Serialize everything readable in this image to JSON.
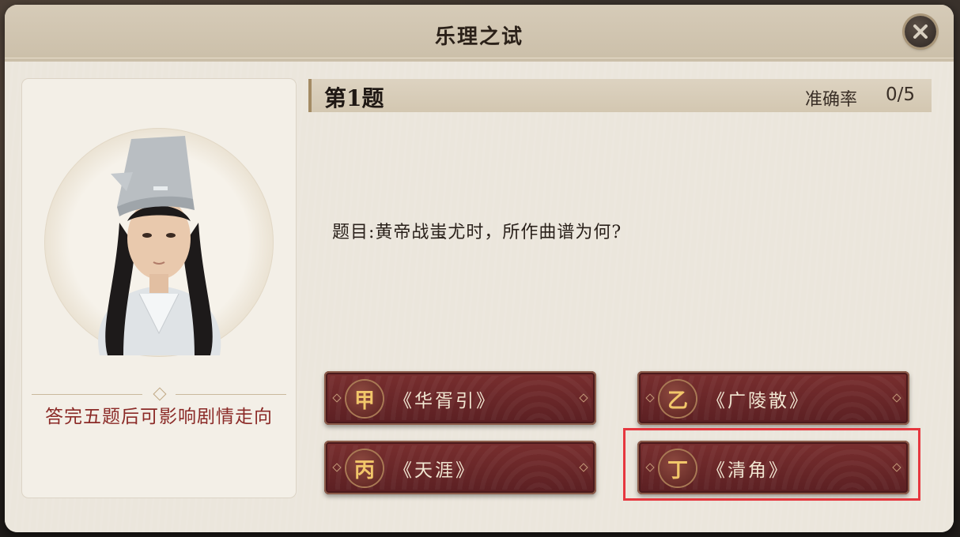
{
  "dialog": {
    "title": "乐理之试",
    "close_icon": "close-x-icon"
  },
  "left_panel": {
    "portrait": "npc-scholar-portrait",
    "hint": "答完五题后可影响剧情走向"
  },
  "question": {
    "number_label": "第1题",
    "accuracy_label": "准确率",
    "accuracy_value": "0/5",
    "text": "题目:黄帝战蚩尤时，所作曲谱为何?"
  },
  "options": [
    {
      "marker": "甲",
      "label": "《华胥引》"
    },
    {
      "marker": "乙",
      "label": "《广陵散》"
    },
    {
      "marker": "丙",
      "label": "《天涯》"
    },
    {
      "marker": "丁",
      "label": "《清角》"
    }
  ],
  "colors": {
    "option_bg": "#6a2628",
    "marker_text": "#f2c76a",
    "hint_text": "#8b2a27",
    "highlight_box": "#e6373f"
  }
}
